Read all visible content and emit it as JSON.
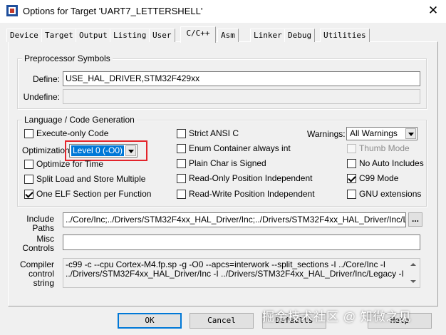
{
  "window": {
    "title": "Options for Target 'UART7_LETTERSHELL'",
    "close_glyph": "✕"
  },
  "tabs": [
    "Device",
    "Target",
    "Output",
    "Listing",
    "User",
    "C/C++",
    "Asm",
    "Linker",
    "Debug",
    "Utilities"
  ],
  "preprocessor": {
    "title": "Preprocessor Symbols",
    "define_label": "Define:",
    "define_value": "USE_HAL_DRIVER,STM32F429xx",
    "undefine_label": "Undefine:",
    "undefine_value": ""
  },
  "language": {
    "title": "Language / Code Generation",
    "execute_only": "Execute-only Code",
    "optimization_label": "Optimization:",
    "optimization_value": "Level 0 (-O0)",
    "optimize_time": "Optimize for Time",
    "split_load": "Split Load and Store Multiple",
    "one_elf": "One ELF Section per Function",
    "strict_ansi": "Strict ANSI C",
    "enum_container": "Enum Container always int",
    "plain_char": "Plain Char is Signed",
    "ro_pi": "Read-Only Position Independent",
    "rw_pi": "Read-Write Position Independent",
    "warnings_label": "Warnings:",
    "warnings_value": "All Warnings",
    "thumb_mode": "Thumb Mode",
    "no_auto": "No Auto Includes",
    "c99_mode": "C99 Mode",
    "gnu_ext": "GNU extensions"
  },
  "include_paths": {
    "label_line1": "Include",
    "label_line2": "Paths",
    "value": "../Core/Inc;../Drivers/STM32F4xx_HAL_Driver/Inc;../Drivers/STM32F4xx_HAL_Driver/Inc/Legacy;",
    "browse": "..."
  },
  "misc_controls": {
    "label_line1": "Misc",
    "label_line2": "Controls",
    "value": ""
  },
  "compiler_control": {
    "label_line1": "Compiler",
    "label_line2": "control",
    "label_line3": "string",
    "value": "-c99 -c --cpu Cortex-M4.fp.sp -g -O0 --apcs=interwork --split_sections -I ../Core/Inc -I ../Drivers/STM32F4xx_HAL_Driver/Inc -I ../Drivers/STM32F4xx_HAL_Driver/Inc/Legacy -I"
  },
  "buttons": {
    "ok": "OK",
    "cancel": "Cancel",
    "defaults": "Defaults",
    "help": "Help"
  },
  "watermark": "掘金技术社区 @ 知微之见",
  "colors": {
    "highlight": "#0078d7",
    "annotation_box": "#e3242b"
  }
}
